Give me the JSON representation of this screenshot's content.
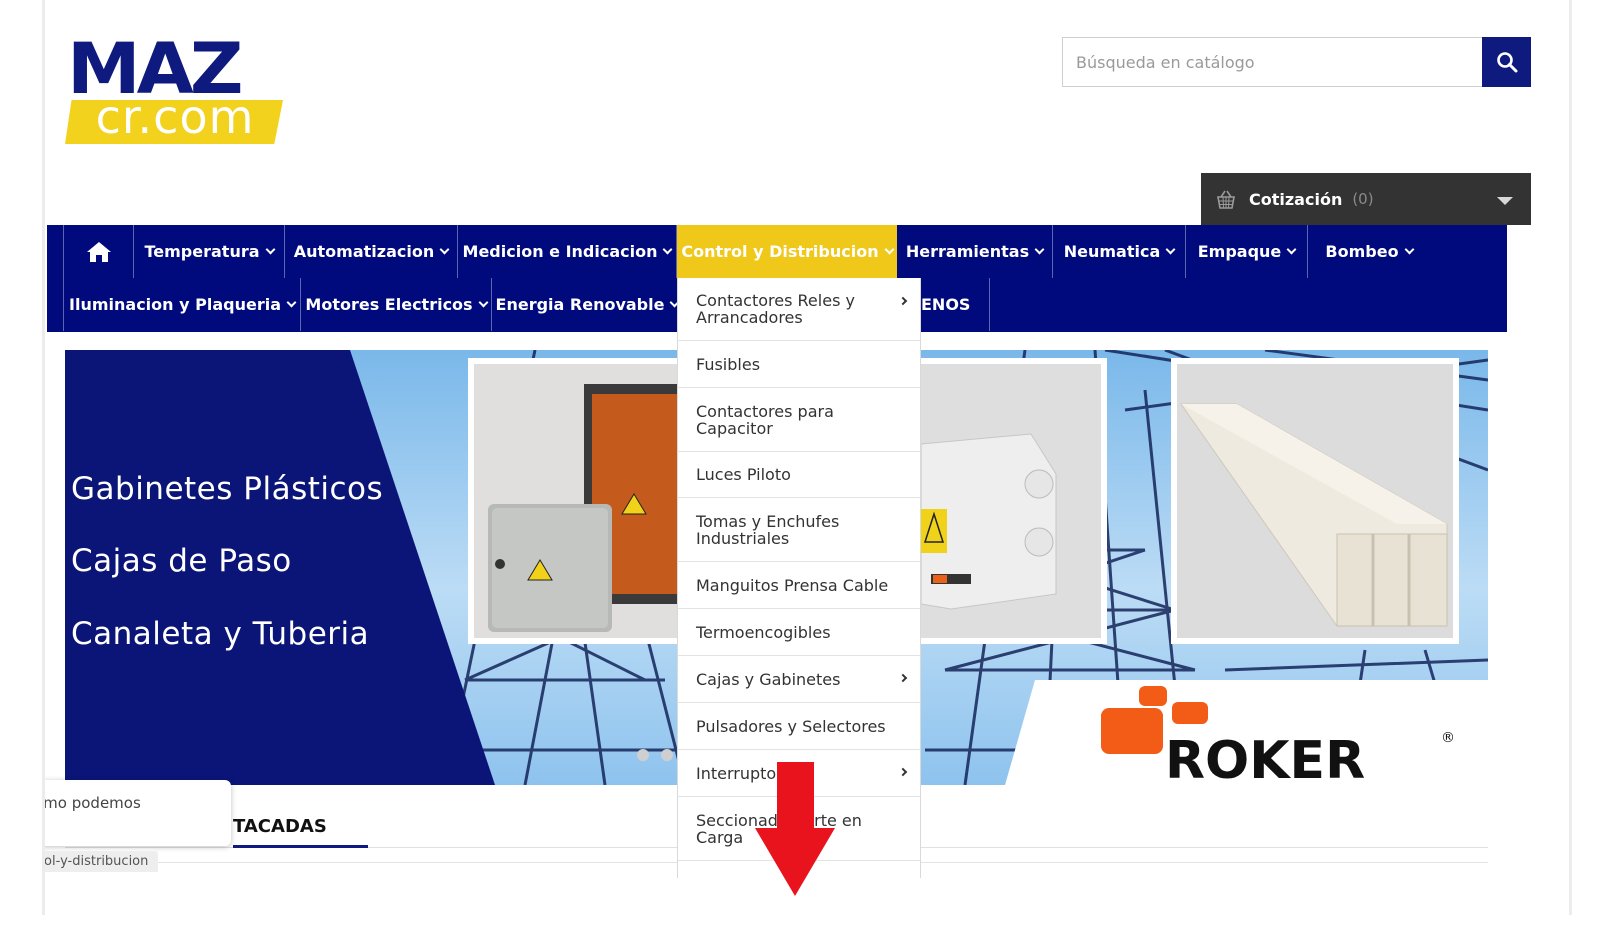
{
  "brand": {
    "logo_top": "MAZ",
    "logo_bottom": "cr.com",
    "primary_color": "#000a7d",
    "accent_color": "#f0c81a"
  },
  "search": {
    "placeholder": "Búsqueda en catálogo",
    "icon": "search-icon"
  },
  "cart": {
    "label": "Cotización",
    "count": "(0)",
    "icon": "basket-icon"
  },
  "nav": {
    "home_icon": "home-icon",
    "row1": [
      "Temperatura",
      "Automatizacion",
      "Medicion e Indicacion",
      "Control y Distribucion",
      "Herramientas",
      "Neumatica",
      "Empaque",
      "Bombeo"
    ],
    "row2": [
      "Iluminacion y Plaqueria",
      "Motores Electricos",
      "Energia Renovable",
      "ENOS"
    ],
    "active": "Control y Distribucion"
  },
  "dropdown": {
    "items": [
      {
        "label": "Contactores Reles y Arrancadores",
        "has_submenu": true
      },
      {
        "label": "Fusibles",
        "has_submenu": false
      },
      {
        "label": "Contactores para Capacitor",
        "has_submenu": false
      },
      {
        "label": "Luces Piloto",
        "has_submenu": false
      },
      {
        "label": "Tomas y Enchufes Industriales",
        "has_submenu": false
      },
      {
        "label": "Manguitos Prensa Cable",
        "has_submenu": false
      },
      {
        "label": "Termoencogibles",
        "has_submenu": false
      },
      {
        "label": "Cajas y Gabinetes",
        "has_submenu": true
      },
      {
        "label": "Pulsadores y Selectores",
        "has_submenu": false
      },
      {
        "label": "Interruptor",
        "has_submenu": true
      },
      {
        "label": "Seccionad   Corte en Carga",
        "has_submenu": false
      }
    ]
  },
  "banner": {
    "lines": [
      "Gabinetes Plásticos",
      "Cajas de Paso",
      "Canaleta y Tuberia"
    ],
    "brand": "ROKER"
  },
  "section": {
    "tab_label": "TACADAS"
  },
  "toast": {
    "text": "ımo podemos"
  },
  "status_url": "rol-y-distribucion"
}
